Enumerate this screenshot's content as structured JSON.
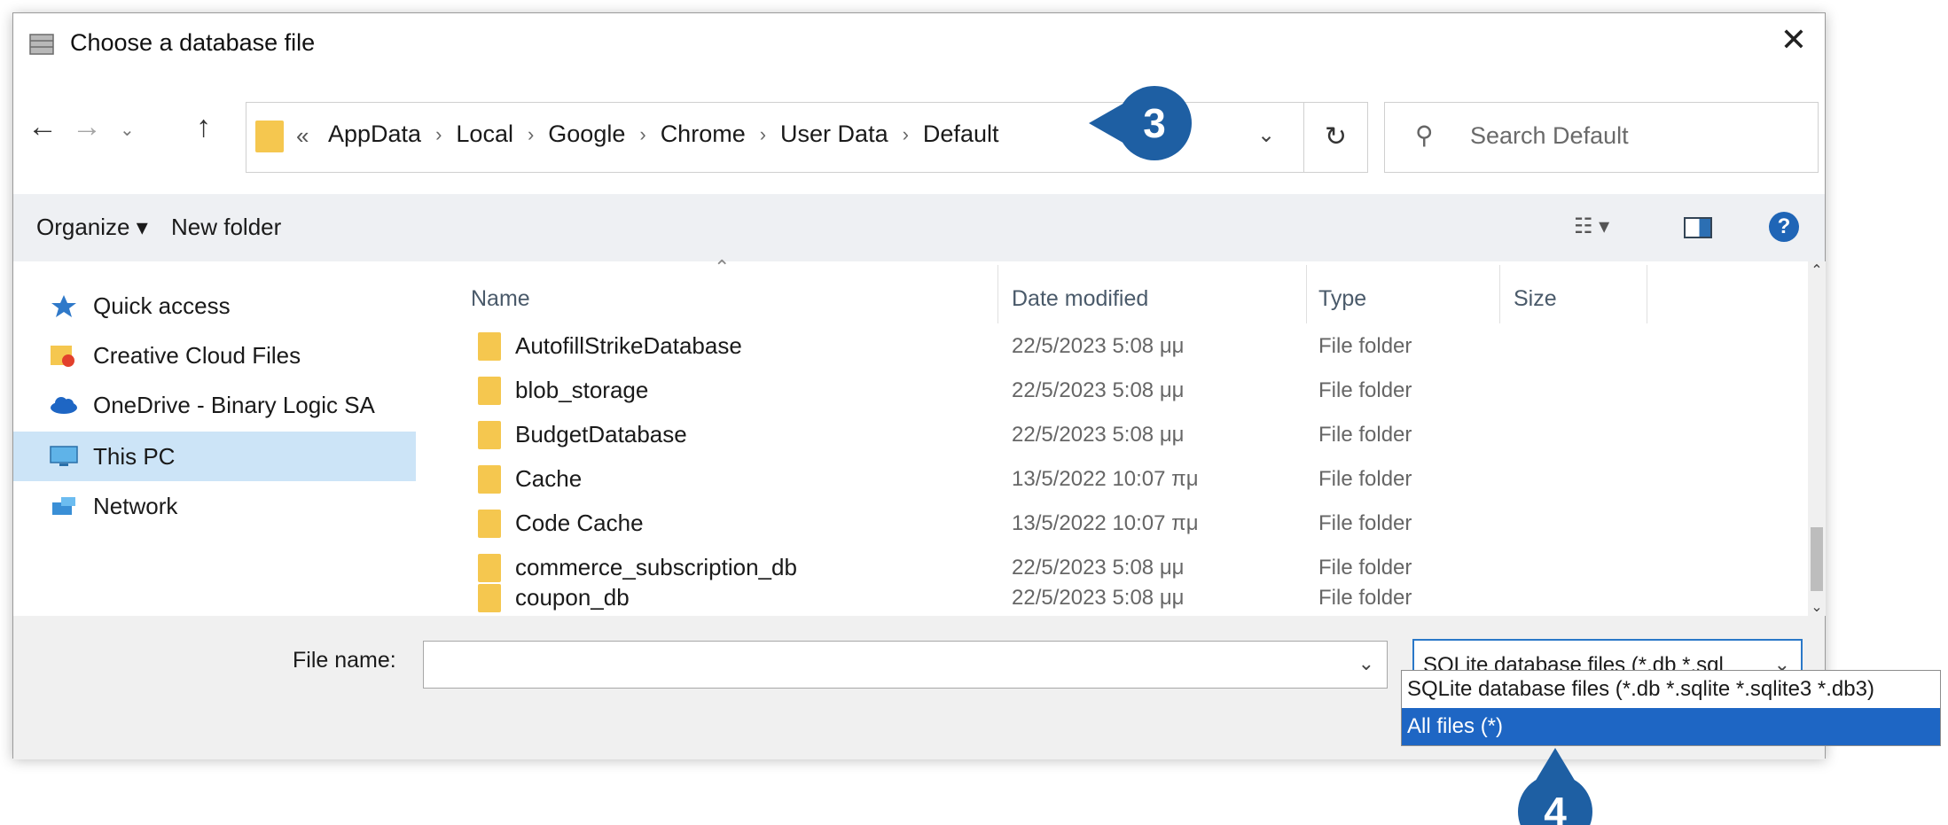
{
  "window": {
    "title": "Choose a database file"
  },
  "nav": {
    "overflow_glyph": "«",
    "breadcrumbs": [
      "AppData",
      "Local",
      "Google",
      "Chrome",
      "User Data",
      "Default"
    ]
  },
  "search": {
    "placeholder": "Search Default"
  },
  "toolbar": {
    "organize": "Organize ▾",
    "new_folder": "New folder"
  },
  "sidebar": {
    "items": [
      {
        "label": "Quick access",
        "icon": "star-icon"
      },
      {
        "label": "Creative Cloud Files",
        "icon": "creative-cloud-folder-icon"
      },
      {
        "label": "OneDrive - Binary Logic SA",
        "icon": "cloud-icon"
      },
      {
        "label": "This PC",
        "icon": "monitor-icon",
        "selected": true
      },
      {
        "label": "Network",
        "icon": "network-icon"
      }
    ]
  },
  "columns": {
    "name": "Name",
    "date": "Date modified",
    "type": "Type",
    "size": "Size"
  },
  "files": [
    {
      "name": "AutofillStrikeDatabase",
      "date": "22/5/2023 5:08 μμ",
      "type": "File folder"
    },
    {
      "name": "blob_storage",
      "date": "22/5/2023 5:08 μμ",
      "type": "File folder"
    },
    {
      "name": "BudgetDatabase",
      "date": "22/5/2023 5:08 μμ",
      "type": "File folder"
    },
    {
      "name": "Cache",
      "date": "13/5/2022 10:07 πμ",
      "type": "File folder"
    },
    {
      "name": "Code Cache",
      "date": "13/5/2022 10:07 πμ",
      "type": "File folder"
    },
    {
      "name": "commerce_subscription_db",
      "date": "22/5/2023 5:08 μμ",
      "type": "File folder"
    },
    {
      "name": "coupon_db",
      "date": "22/5/2023 5:08 μμ",
      "type": "File folder"
    }
  ],
  "footer": {
    "file_name_label": "File name:",
    "file_name_value": "",
    "filter_selected": "SQLite database files (*.db *.sql",
    "filter_options": [
      "SQLite database files (*.db *.sqlite *.sqlite3 *.db3)",
      "All files (*)"
    ]
  },
  "annotations": {
    "badge_1": "3",
    "badge_2": "4"
  },
  "colors": {
    "accent": "#1e5fa3",
    "selection": "#cce4f7",
    "folder": "#f5c74f",
    "highlight": "#1e66c4"
  }
}
